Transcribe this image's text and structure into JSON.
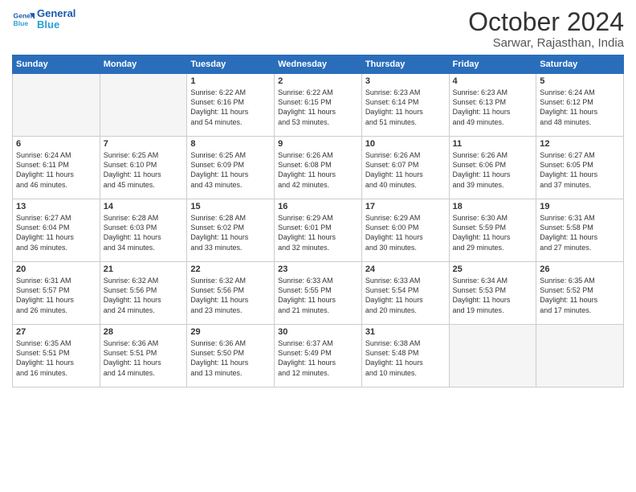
{
  "header": {
    "logo_line1": "General",
    "logo_line2": "Blue",
    "month": "October 2024",
    "location": "Sarwar, Rajasthan, India"
  },
  "weekdays": [
    "Sunday",
    "Monday",
    "Tuesday",
    "Wednesday",
    "Thursday",
    "Friday",
    "Saturday"
  ],
  "weeks": [
    [
      {
        "day": "",
        "info": ""
      },
      {
        "day": "",
        "info": ""
      },
      {
        "day": "1",
        "info": "Sunrise: 6:22 AM\nSunset: 6:16 PM\nDaylight: 11 hours\nand 54 minutes."
      },
      {
        "day": "2",
        "info": "Sunrise: 6:22 AM\nSunset: 6:15 PM\nDaylight: 11 hours\nand 53 minutes."
      },
      {
        "day": "3",
        "info": "Sunrise: 6:23 AM\nSunset: 6:14 PM\nDaylight: 11 hours\nand 51 minutes."
      },
      {
        "day": "4",
        "info": "Sunrise: 6:23 AM\nSunset: 6:13 PM\nDaylight: 11 hours\nand 49 minutes."
      },
      {
        "day": "5",
        "info": "Sunrise: 6:24 AM\nSunset: 6:12 PM\nDaylight: 11 hours\nand 48 minutes."
      }
    ],
    [
      {
        "day": "6",
        "info": "Sunrise: 6:24 AM\nSunset: 6:11 PM\nDaylight: 11 hours\nand 46 minutes."
      },
      {
        "day": "7",
        "info": "Sunrise: 6:25 AM\nSunset: 6:10 PM\nDaylight: 11 hours\nand 45 minutes."
      },
      {
        "day": "8",
        "info": "Sunrise: 6:25 AM\nSunset: 6:09 PM\nDaylight: 11 hours\nand 43 minutes."
      },
      {
        "day": "9",
        "info": "Sunrise: 6:26 AM\nSunset: 6:08 PM\nDaylight: 11 hours\nand 42 minutes."
      },
      {
        "day": "10",
        "info": "Sunrise: 6:26 AM\nSunset: 6:07 PM\nDaylight: 11 hours\nand 40 minutes."
      },
      {
        "day": "11",
        "info": "Sunrise: 6:26 AM\nSunset: 6:06 PM\nDaylight: 11 hours\nand 39 minutes."
      },
      {
        "day": "12",
        "info": "Sunrise: 6:27 AM\nSunset: 6:05 PM\nDaylight: 11 hours\nand 37 minutes."
      }
    ],
    [
      {
        "day": "13",
        "info": "Sunrise: 6:27 AM\nSunset: 6:04 PM\nDaylight: 11 hours\nand 36 minutes."
      },
      {
        "day": "14",
        "info": "Sunrise: 6:28 AM\nSunset: 6:03 PM\nDaylight: 11 hours\nand 34 minutes."
      },
      {
        "day": "15",
        "info": "Sunrise: 6:28 AM\nSunset: 6:02 PM\nDaylight: 11 hours\nand 33 minutes."
      },
      {
        "day": "16",
        "info": "Sunrise: 6:29 AM\nSunset: 6:01 PM\nDaylight: 11 hours\nand 32 minutes."
      },
      {
        "day": "17",
        "info": "Sunrise: 6:29 AM\nSunset: 6:00 PM\nDaylight: 11 hours\nand 30 minutes."
      },
      {
        "day": "18",
        "info": "Sunrise: 6:30 AM\nSunset: 5:59 PM\nDaylight: 11 hours\nand 29 minutes."
      },
      {
        "day": "19",
        "info": "Sunrise: 6:31 AM\nSunset: 5:58 PM\nDaylight: 11 hours\nand 27 minutes."
      }
    ],
    [
      {
        "day": "20",
        "info": "Sunrise: 6:31 AM\nSunset: 5:57 PM\nDaylight: 11 hours\nand 26 minutes."
      },
      {
        "day": "21",
        "info": "Sunrise: 6:32 AM\nSunset: 5:56 PM\nDaylight: 11 hours\nand 24 minutes."
      },
      {
        "day": "22",
        "info": "Sunrise: 6:32 AM\nSunset: 5:56 PM\nDaylight: 11 hours\nand 23 minutes."
      },
      {
        "day": "23",
        "info": "Sunrise: 6:33 AM\nSunset: 5:55 PM\nDaylight: 11 hours\nand 21 minutes."
      },
      {
        "day": "24",
        "info": "Sunrise: 6:33 AM\nSunset: 5:54 PM\nDaylight: 11 hours\nand 20 minutes."
      },
      {
        "day": "25",
        "info": "Sunrise: 6:34 AM\nSunset: 5:53 PM\nDaylight: 11 hours\nand 19 minutes."
      },
      {
        "day": "26",
        "info": "Sunrise: 6:35 AM\nSunset: 5:52 PM\nDaylight: 11 hours\nand 17 minutes."
      }
    ],
    [
      {
        "day": "27",
        "info": "Sunrise: 6:35 AM\nSunset: 5:51 PM\nDaylight: 11 hours\nand 16 minutes."
      },
      {
        "day": "28",
        "info": "Sunrise: 6:36 AM\nSunset: 5:51 PM\nDaylight: 11 hours\nand 14 minutes."
      },
      {
        "day": "29",
        "info": "Sunrise: 6:36 AM\nSunset: 5:50 PM\nDaylight: 11 hours\nand 13 minutes."
      },
      {
        "day": "30",
        "info": "Sunrise: 6:37 AM\nSunset: 5:49 PM\nDaylight: 11 hours\nand 12 minutes."
      },
      {
        "day": "31",
        "info": "Sunrise: 6:38 AM\nSunset: 5:48 PM\nDaylight: 11 hours\nand 10 minutes."
      },
      {
        "day": "",
        "info": ""
      },
      {
        "day": "",
        "info": ""
      }
    ]
  ]
}
